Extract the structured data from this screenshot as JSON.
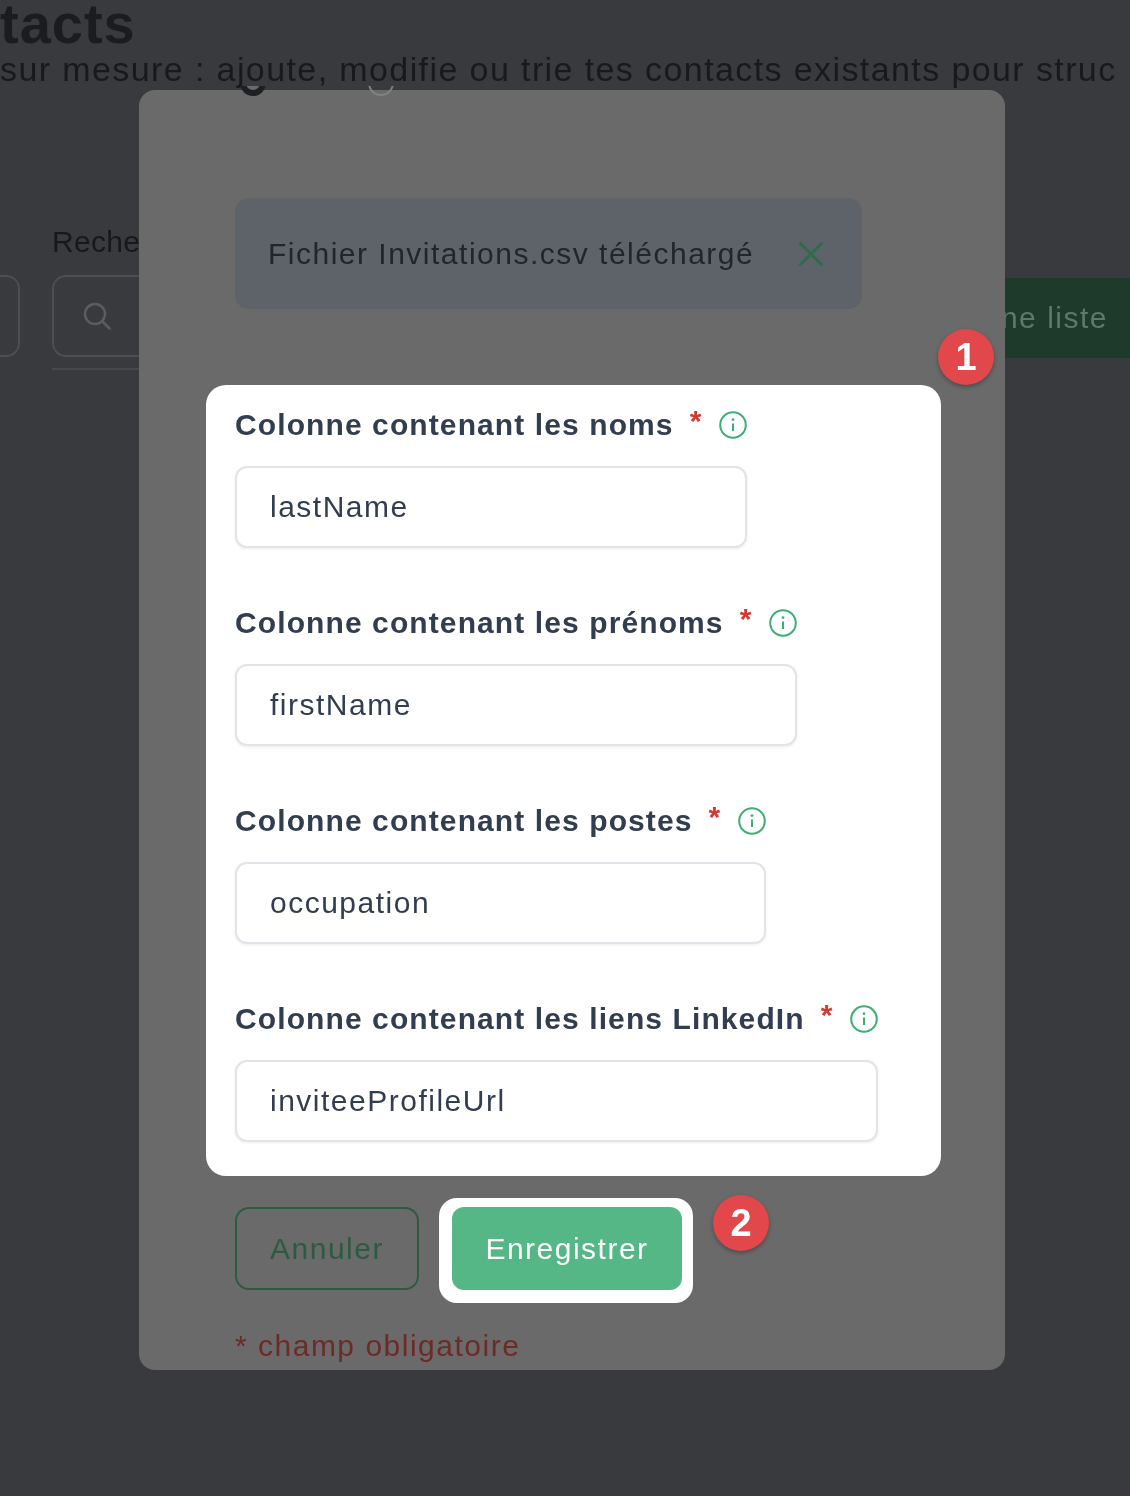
{
  "page": {
    "title": "tacts",
    "subtitle": "sur mesure : ajoute, modifie ou trie tes contacts existants pour struc",
    "search_label": "Reche",
    "create_button": "ne liste"
  },
  "modal": {
    "options": [
      {
        "selected": true
      },
      {
        "selected": false
      }
    ],
    "file_banner": {
      "text": "Fichier Invitations.csv téléchargé"
    },
    "form": {
      "highlighted": true,
      "callout": "1",
      "fields": [
        {
          "label": "Colonne contenant les noms",
          "required_mark": "*",
          "value": "lastName"
        },
        {
          "label": "Colonne contenant les prénoms",
          "required_mark": "*",
          "value": "firstName"
        },
        {
          "label": "Colonne contenant les postes",
          "required_mark": "*",
          "value": "occupation"
        },
        {
          "label": "Colonne contenant les liens LinkedIn",
          "required_mark": "*",
          "value": "inviteeProfileUrl"
        }
      ]
    },
    "buttons": [
      {
        "kind": "secondary",
        "label": "Annuler",
        "highlighted": false
      },
      {
        "kind": "primary",
        "label": "Enregistrer",
        "highlighted": true,
        "callout": "2"
      }
    ],
    "required_note": "* champ obligatoire"
  }
}
